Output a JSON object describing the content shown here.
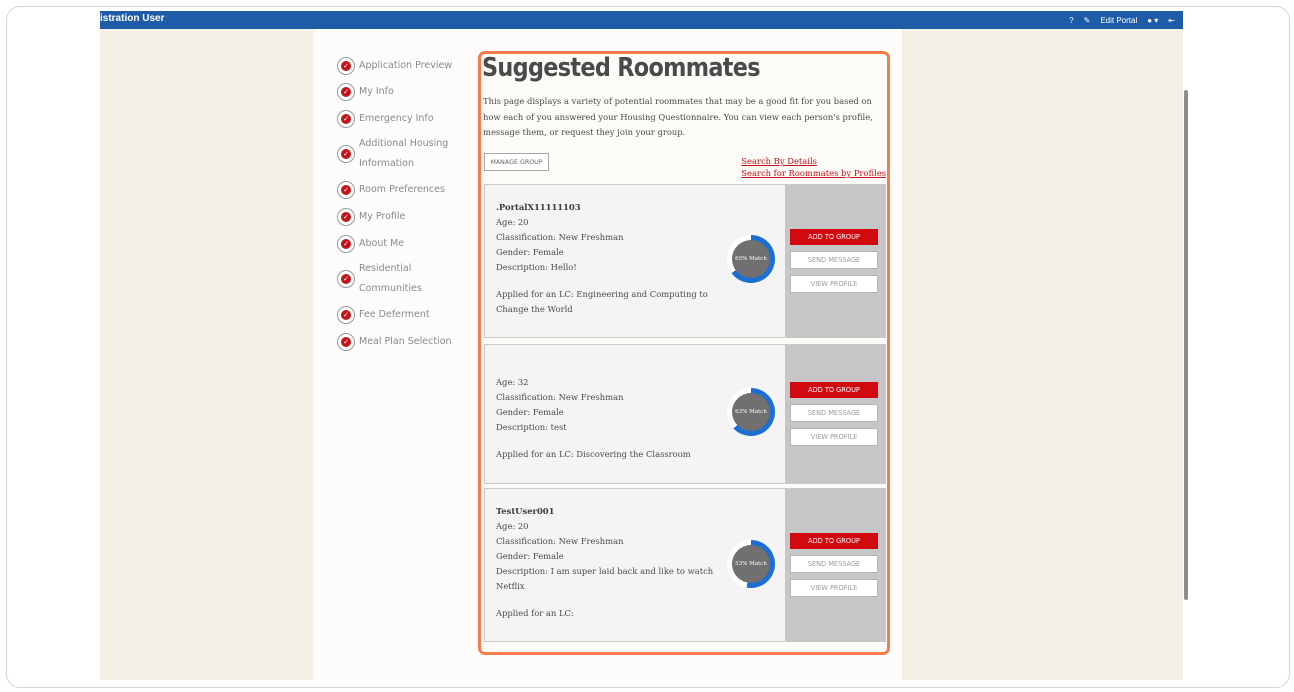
{
  "header": {
    "user_label": "istration User",
    "edit_portal": "Edit Portal"
  },
  "sidebar": {
    "items": [
      {
        "label": "Application Preview"
      },
      {
        "label": "My Info"
      },
      {
        "label": "Emergency Info"
      },
      {
        "label": "Additional Housing Information"
      },
      {
        "label": "Room Preferences"
      },
      {
        "label": "My Profile"
      },
      {
        "label": "About Me"
      },
      {
        "label": "Residential Communities"
      },
      {
        "label": "Fee Deferment"
      },
      {
        "label": "Meal Plan Selection"
      }
    ]
  },
  "main": {
    "title": "Suggested Roommates",
    "description": "This page displays a variety of potential roommates that may be a good fit for you based on how each of you answered your Housing Questionnaire. You can view each person's profile, message them, or request they join your group.",
    "manage_group": "MANAGE GROUP",
    "search_by_details": "Search By Details",
    "search_by_profiles": "Search for Roommates by Profiles",
    "buttons": {
      "add": "ADD TO GROUP",
      "message": "SEND MESSAGE",
      "profile": "VIEW PROFILE"
    },
    "roommates": [
      {
        "name": ".PortalX11111103",
        "age": "Age: 20",
        "classification": "Classification: New Freshman",
        "gender": "Gender: Female",
        "description": "Description: Hello!",
        "lc": "Applied for an LC: Engineering and Computing to Change the World",
        "match": "65% Match",
        "match_pct": 65
      },
      {
        "name": "",
        "age": "Age: 32",
        "classification": "Classification: New Freshman",
        "gender": "Gender: Female",
        "description": "Description: test",
        "lc": "Applied for an LC: Discovering the Classroom",
        "match": "63% Match",
        "match_pct": 63
      },
      {
        "name": "TestUser001",
        "age": "Age: 20",
        "classification": "Classification: New Freshman",
        "gender": "Gender: Female",
        "description": "Description: I am super laid back and like to watch Netflix",
        "lc": "Applied for an LC:",
        "match": "53% Match",
        "match_pct": 53
      }
    ]
  },
  "colors": {
    "accent_red": "#d10a10",
    "header_blue": "#1f5ca8",
    "highlight_orange": "#f57d4c",
    "ring_blue": "#1a6fd1"
  }
}
